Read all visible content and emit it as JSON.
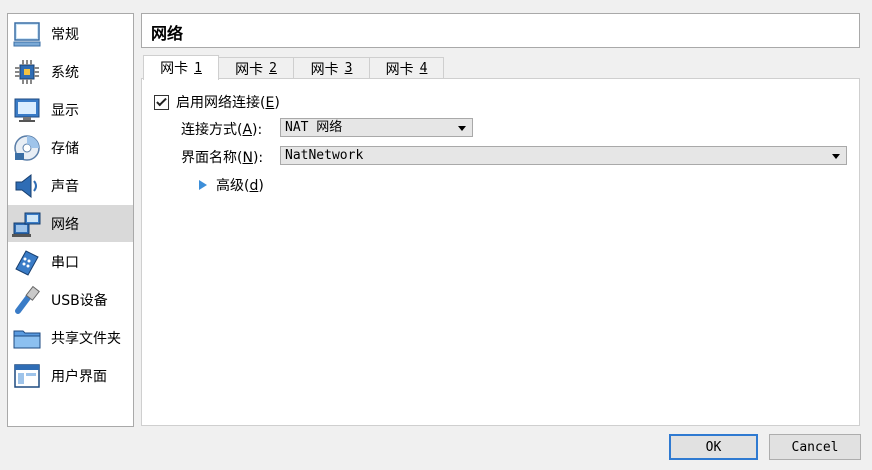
{
  "sidebar": {
    "items": [
      {
        "label": "常规",
        "icon": "monitor-general-icon",
        "active": false
      },
      {
        "label": "系统",
        "icon": "chip-system-icon",
        "active": false
      },
      {
        "label": "显示",
        "icon": "display-icon",
        "active": false
      },
      {
        "label": "存储",
        "icon": "storage-disk-icon",
        "active": false
      },
      {
        "label": "声音",
        "icon": "speaker-icon",
        "active": false
      },
      {
        "label": "网络",
        "icon": "network-icon",
        "active": true
      },
      {
        "label": "串口",
        "icon": "serial-port-icon",
        "active": false
      },
      {
        "label": "USB设备",
        "icon": "usb-icon",
        "active": false
      },
      {
        "label": "共享文件夹",
        "icon": "shared-folder-icon",
        "active": false
      },
      {
        "label": "用户界面",
        "icon": "user-interface-icon",
        "active": false
      }
    ]
  },
  "page": {
    "title": "网络"
  },
  "tabs": [
    {
      "label": "网卡",
      "num": "1",
      "active": true
    },
    {
      "label": "网卡",
      "num": "2",
      "active": false
    },
    {
      "label": "网卡",
      "num": "3",
      "active": false
    },
    {
      "label": "网卡",
      "num": "4",
      "active": false
    }
  ],
  "adapter": {
    "enable": {
      "label_pre": "启用网络连接(",
      "mnemonic": "E",
      "label_post": ")",
      "checked": true
    },
    "attached": {
      "label_pre": "连接方式(",
      "mnemonic": "A",
      "label_post": "):",
      "value": "NAT 网络"
    },
    "name": {
      "label_pre": "界面名称(",
      "mnemonic": "N",
      "label_post": "):",
      "value": "NatNetwork"
    },
    "advanced": {
      "label_pre": "高级(",
      "mnemonic": "d",
      "label_post": ")"
    }
  },
  "buttons": {
    "ok": "OK",
    "cancel": "Cancel"
  },
  "colors": {
    "accent": "#2f7ad1",
    "selected_bg": "#d9d9d9",
    "triangle": "#3d8fd9"
  }
}
